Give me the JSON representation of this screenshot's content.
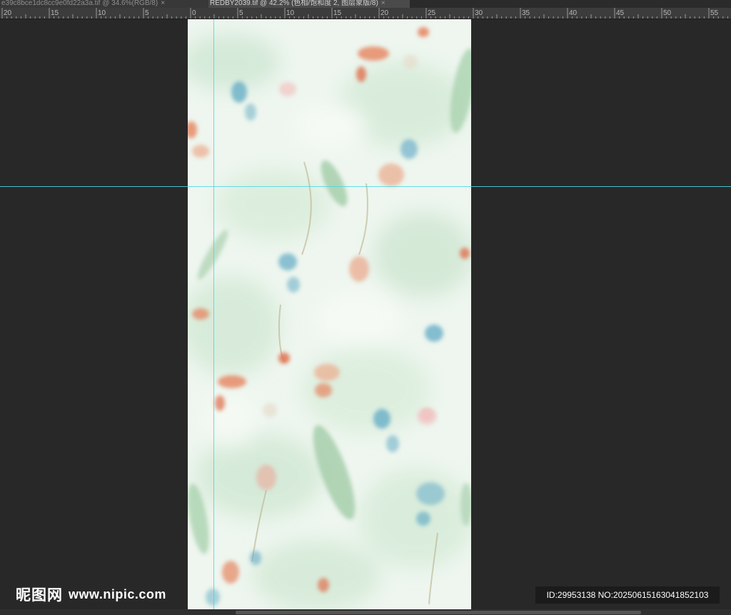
{
  "tabs": [
    {
      "label": "e39c8bce1dc8cc9e0fd22a3a.tif @ 34.6%(RGB/8)",
      "active": false
    },
    {
      "label": "REDBY2039.tif @ 42.2% (色相/饱和度 2, 图层蒙版/8)",
      "active": true
    }
  ],
  "tab_close_glyph": "×",
  "ruler": {
    "labels": [
      "20",
      "15",
      "10",
      "5",
      "0",
      "5",
      "10",
      "15",
      "20",
      "25",
      "30",
      "35",
      "40",
      "45",
      "50",
      "55"
    ]
  },
  "document": {
    "description_colors": {
      "base": "#eef6ef",
      "leaf": "#9cc9a2",
      "coral": "#e6845f",
      "blue": "#5fa9c4"
    }
  },
  "watermark": {
    "logo": "昵图网",
    "url": "www.nipic.com",
    "id_text": "ID:29953138 NO:20250615163041852103"
  },
  "colors": {
    "guide": "#4dd6e4",
    "workspace": "#282828"
  }
}
